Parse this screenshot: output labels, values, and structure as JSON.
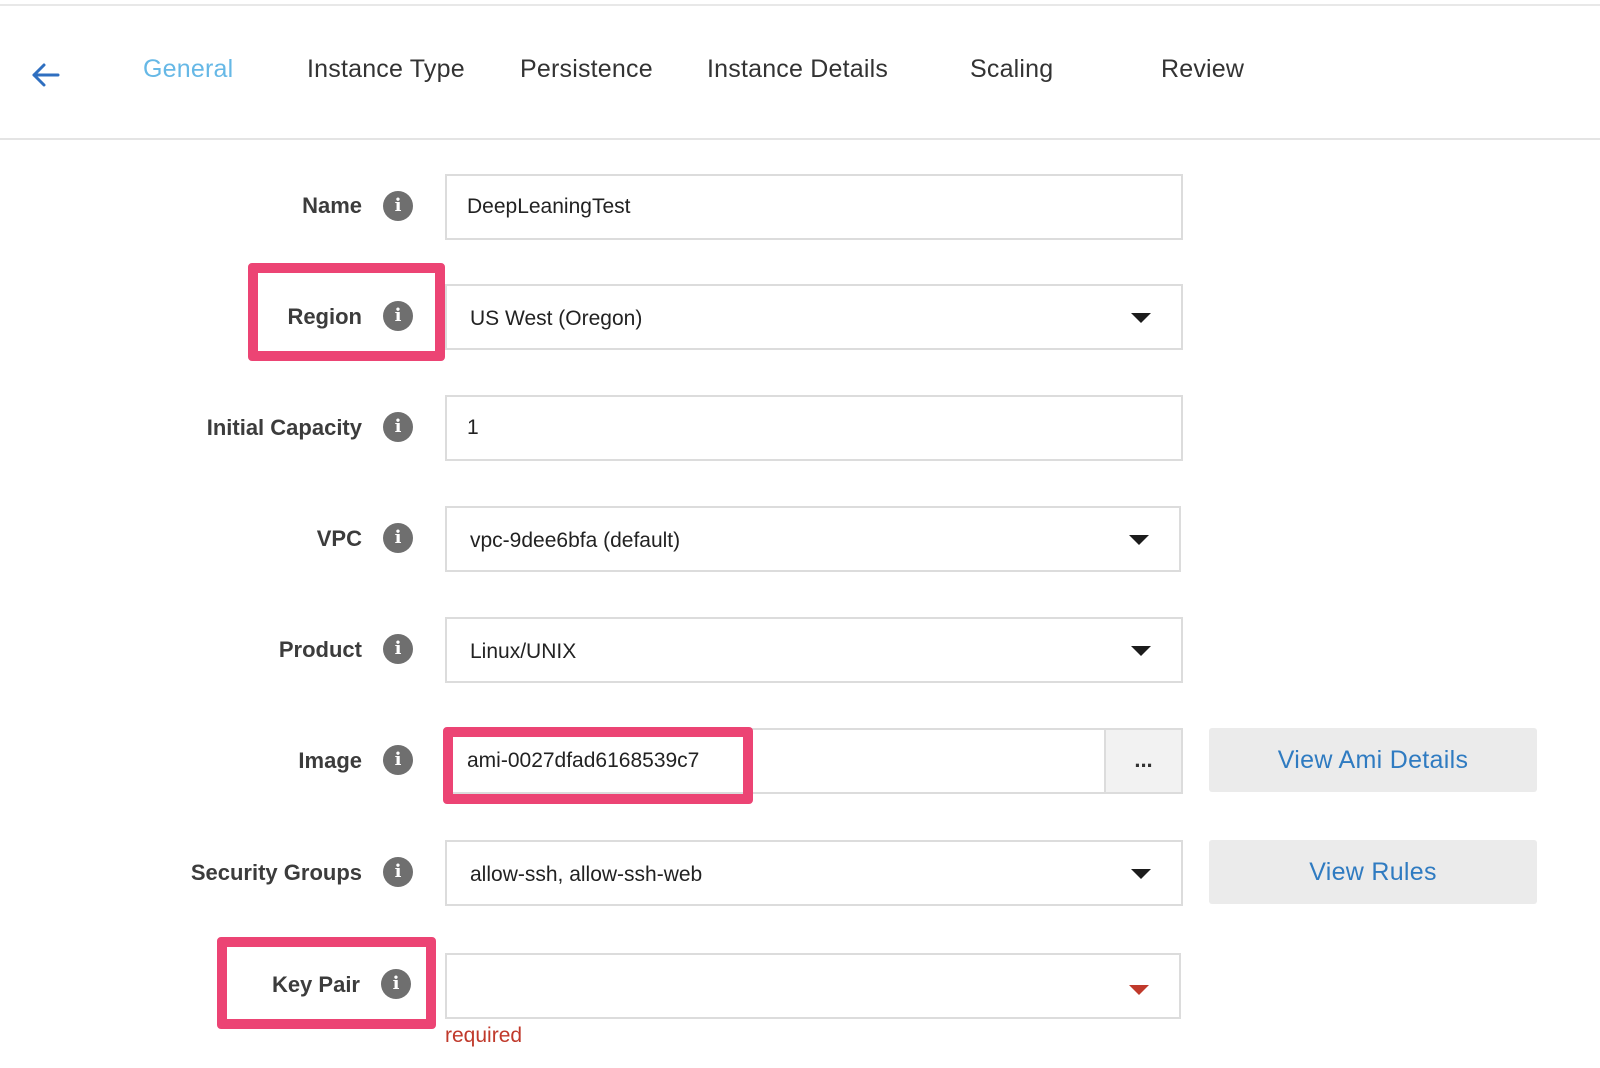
{
  "nav": {
    "back_icon": "arrow-left-icon",
    "steps": [
      {
        "label": "General",
        "active": true
      },
      {
        "label": "Instance Type",
        "active": false
      },
      {
        "label": "Persistence",
        "active": false
      },
      {
        "label": "Instance Details",
        "active": false
      },
      {
        "label": "Scaling",
        "active": false
      },
      {
        "label": "Review",
        "active": false
      }
    ]
  },
  "form": {
    "name": {
      "label": "Name",
      "value": "DeepLeaningTest"
    },
    "region": {
      "label": "Region",
      "value": "US West (Oregon)"
    },
    "initial_capacity": {
      "label": "Initial Capacity",
      "value": "1"
    },
    "vpc": {
      "label": "VPC",
      "value": "vpc-9dee6bfa (default)"
    },
    "product": {
      "label": "Product",
      "value": "Linux/UNIX"
    },
    "image": {
      "label": "Image",
      "value": "ami-0027dfad6168539c7",
      "browse_label": "...",
      "details_button": "View Ami Details"
    },
    "security_groups": {
      "label": "Security Groups",
      "value": "allow-ssh, allow-ssh-web",
      "rules_button": "View Rules"
    },
    "key_pair": {
      "label": "Key Pair",
      "value": "",
      "error": "required"
    }
  },
  "info_icon": {
    "glyph": "i",
    "name": "info-icon"
  },
  "colors": {
    "active_step": "#66b8e6",
    "link": "#2f7bc1",
    "highlight": "#ec4474",
    "error": "#c0392b"
  }
}
